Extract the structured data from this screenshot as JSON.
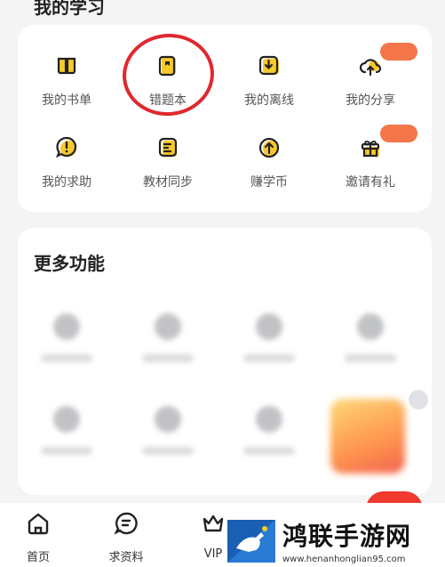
{
  "my_study": {
    "title": "我的学习",
    "items": [
      {
        "label": "我的书单",
        "icon": "book-icon"
      },
      {
        "label": "错题本",
        "icon": "notebook-icon"
      },
      {
        "label": "我的离线",
        "icon": "download-icon"
      },
      {
        "label": "我的分享",
        "icon": "upload-cloud-icon"
      },
      {
        "label": "我的求助",
        "icon": "alert-bubble-icon"
      },
      {
        "label": "教材同步",
        "icon": "textbook-icon"
      },
      {
        "label": "赚学币",
        "icon": "coin-arrow-icon"
      },
      {
        "label": "邀请有礼",
        "icon": "gift-icon"
      }
    ]
  },
  "more_functions": {
    "title": "更多功能"
  },
  "bottom_nav": {
    "tabs": [
      {
        "label": "首页",
        "icon": "home-icon"
      },
      {
        "label": "求资料",
        "icon": "search-bubble-icon"
      },
      {
        "label": "VIP",
        "icon": "crown-icon"
      }
    ]
  },
  "watermark": {
    "title": "鸿联手游网",
    "url": "www.henanhonglian95.com"
  },
  "colors": {
    "accent_yellow": "#f7c92a",
    "highlight_red": "#e0282e",
    "badge_orange": "#f4754a"
  }
}
